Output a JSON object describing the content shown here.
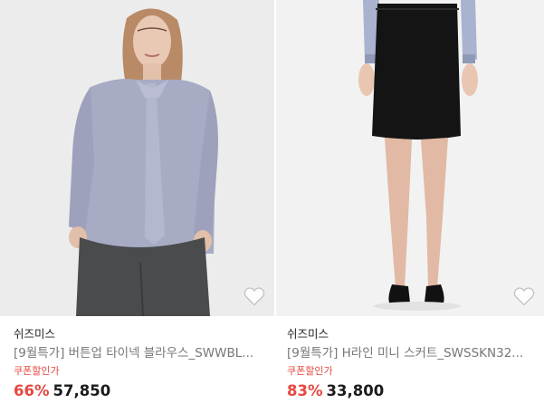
{
  "products": [
    {
      "brand": "쉬즈미스",
      "title": "[9월특가] 버튼업 타이넥 블라우스_SWWBL...",
      "coupon_label": "쿠폰할인가",
      "discount": "66%",
      "price": "57,850",
      "image_icon": "blouse-model-photo",
      "wishlist_icon": "heart-outline-icon"
    },
    {
      "brand": "쉬즈미스",
      "title": "[9월특가] H라인 미니 스커트_SWSSKN32...",
      "coupon_label": "쿠폰할인가",
      "discount": "83%",
      "price": "33,800",
      "image_icon": "skirt-model-photo",
      "wishlist_icon": "heart-outline-icon"
    }
  ],
  "colors": {
    "accent_red": "#e5483f",
    "price_text": "#1b1b1b",
    "title_gray": "#777777"
  }
}
